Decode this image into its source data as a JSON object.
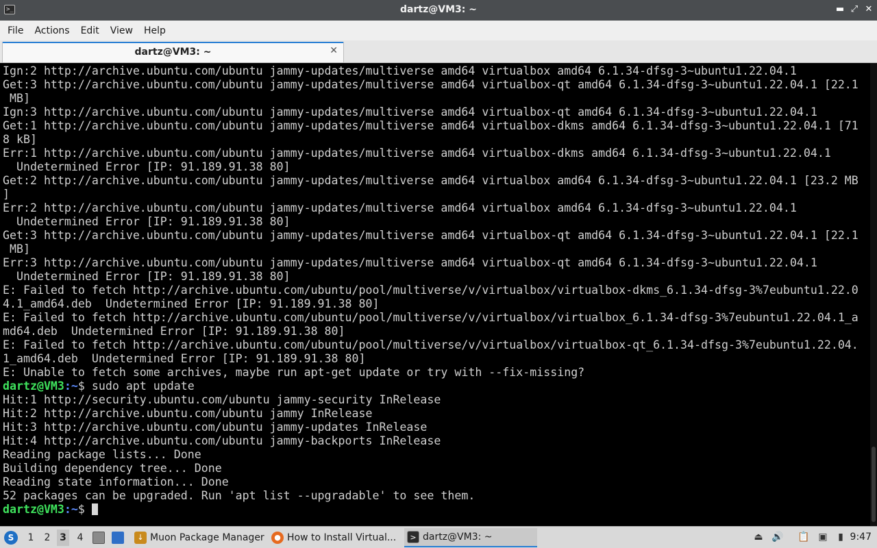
{
  "window": {
    "title": "dartz@VM3: ~",
    "controls": {
      "minimize": "▬",
      "maximize": "⤢",
      "close": "✕"
    }
  },
  "menu": [
    "File",
    "Actions",
    "Edit",
    "View",
    "Help"
  ],
  "tab": {
    "label": "dartz@VM3: ~",
    "close": "✕"
  },
  "terminal": {
    "lines": [
      "Ign:2 http://archive.ubuntu.com/ubuntu jammy-updates/multiverse amd64 virtualbox amd64 6.1.34-dfsg-3~ubuntu1.22.04.1",
      "Get:3 http://archive.ubuntu.com/ubuntu jammy-updates/multiverse amd64 virtualbox-qt amd64 6.1.34-dfsg-3~ubuntu1.22.04.1 [22.1",
      " MB]",
      "Ign:3 http://archive.ubuntu.com/ubuntu jammy-updates/multiverse amd64 virtualbox-qt amd64 6.1.34-dfsg-3~ubuntu1.22.04.1",
      "Get:1 http://archive.ubuntu.com/ubuntu jammy-updates/multiverse amd64 virtualbox-dkms amd64 6.1.34-dfsg-3~ubuntu1.22.04.1 [71",
      "8 kB]",
      "Err:1 http://archive.ubuntu.com/ubuntu jammy-updates/multiverse amd64 virtualbox-dkms amd64 6.1.34-dfsg-3~ubuntu1.22.04.1",
      "  Undetermined Error [IP: 91.189.91.38 80]",
      "Get:2 http://archive.ubuntu.com/ubuntu jammy-updates/multiverse amd64 virtualbox amd64 6.1.34-dfsg-3~ubuntu1.22.04.1 [23.2 MB",
      "]",
      "Err:2 http://archive.ubuntu.com/ubuntu jammy-updates/multiverse amd64 virtualbox amd64 6.1.34-dfsg-3~ubuntu1.22.04.1",
      "  Undetermined Error [IP: 91.189.91.38 80]",
      "Get:3 http://archive.ubuntu.com/ubuntu jammy-updates/multiverse amd64 virtualbox-qt amd64 6.1.34-dfsg-3~ubuntu1.22.04.1 [22.1",
      " MB]",
      "Err:3 http://archive.ubuntu.com/ubuntu jammy-updates/multiverse amd64 virtualbox-qt amd64 6.1.34-dfsg-3~ubuntu1.22.04.1",
      "  Undetermined Error [IP: 91.189.91.38 80]",
      "E: Failed to fetch http://archive.ubuntu.com/ubuntu/pool/multiverse/v/virtualbox/virtualbox-dkms_6.1.34-dfsg-3%7eubuntu1.22.0",
      "4.1_amd64.deb  Undetermined Error [IP: 91.189.91.38 80]",
      "E: Failed to fetch http://archive.ubuntu.com/ubuntu/pool/multiverse/v/virtualbox/virtualbox_6.1.34-dfsg-3%7eubuntu1.22.04.1_a",
      "md64.deb  Undetermined Error [IP: 91.189.91.38 80]",
      "E: Failed to fetch http://archive.ubuntu.com/ubuntu/pool/multiverse/v/virtualbox/virtualbox-qt_6.1.34-dfsg-3%7eubuntu1.22.04.",
      "1_amd64.deb  Undetermined Error [IP: 91.189.91.38 80]",
      "E: Unable to fetch some archives, maybe run apt-get update or try with --fix-missing?"
    ],
    "prompt_user": "dartz@VM3",
    "prompt_path": ":~",
    "prompt_symbol": "$ ",
    "command": "sudo apt update",
    "output": [
      "Hit:1 http://security.ubuntu.com/ubuntu jammy-security InRelease",
      "Hit:2 http://archive.ubuntu.com/ubuntu jammy InRelease",
      "Hit:3 http://archive.ubuntu.com/ubuntu jammy-updates InRelease",
      "Hit:4 http://archive.ubuntu.com/ubuntu jammy-backports InRelease",
      "Reading package lists... Done",
      "Building dependency tree... Done",
      "Reading state information... Done",
      "52 packages can be upgraded. Run 'apt list --upgradable' to see them."
    ]
  },
  "taskbar": {
    "workspaces": [
      "1",
      "2",
      "3",
      "4"
    ],
    "active_workspace": "3",
    "tasks": [
      {
        "label": "Muon Package Manager",
        "icon": "muon-icon"
      },
      {
        "label": "How to Install Virtual...",
        "icon": "firefox-icon"
      },
      {
        "label": "dartz@VM3: ~",
        "icon": "terminal-icon"
      }
    ],
    "clock": "9:47"
  }
}
